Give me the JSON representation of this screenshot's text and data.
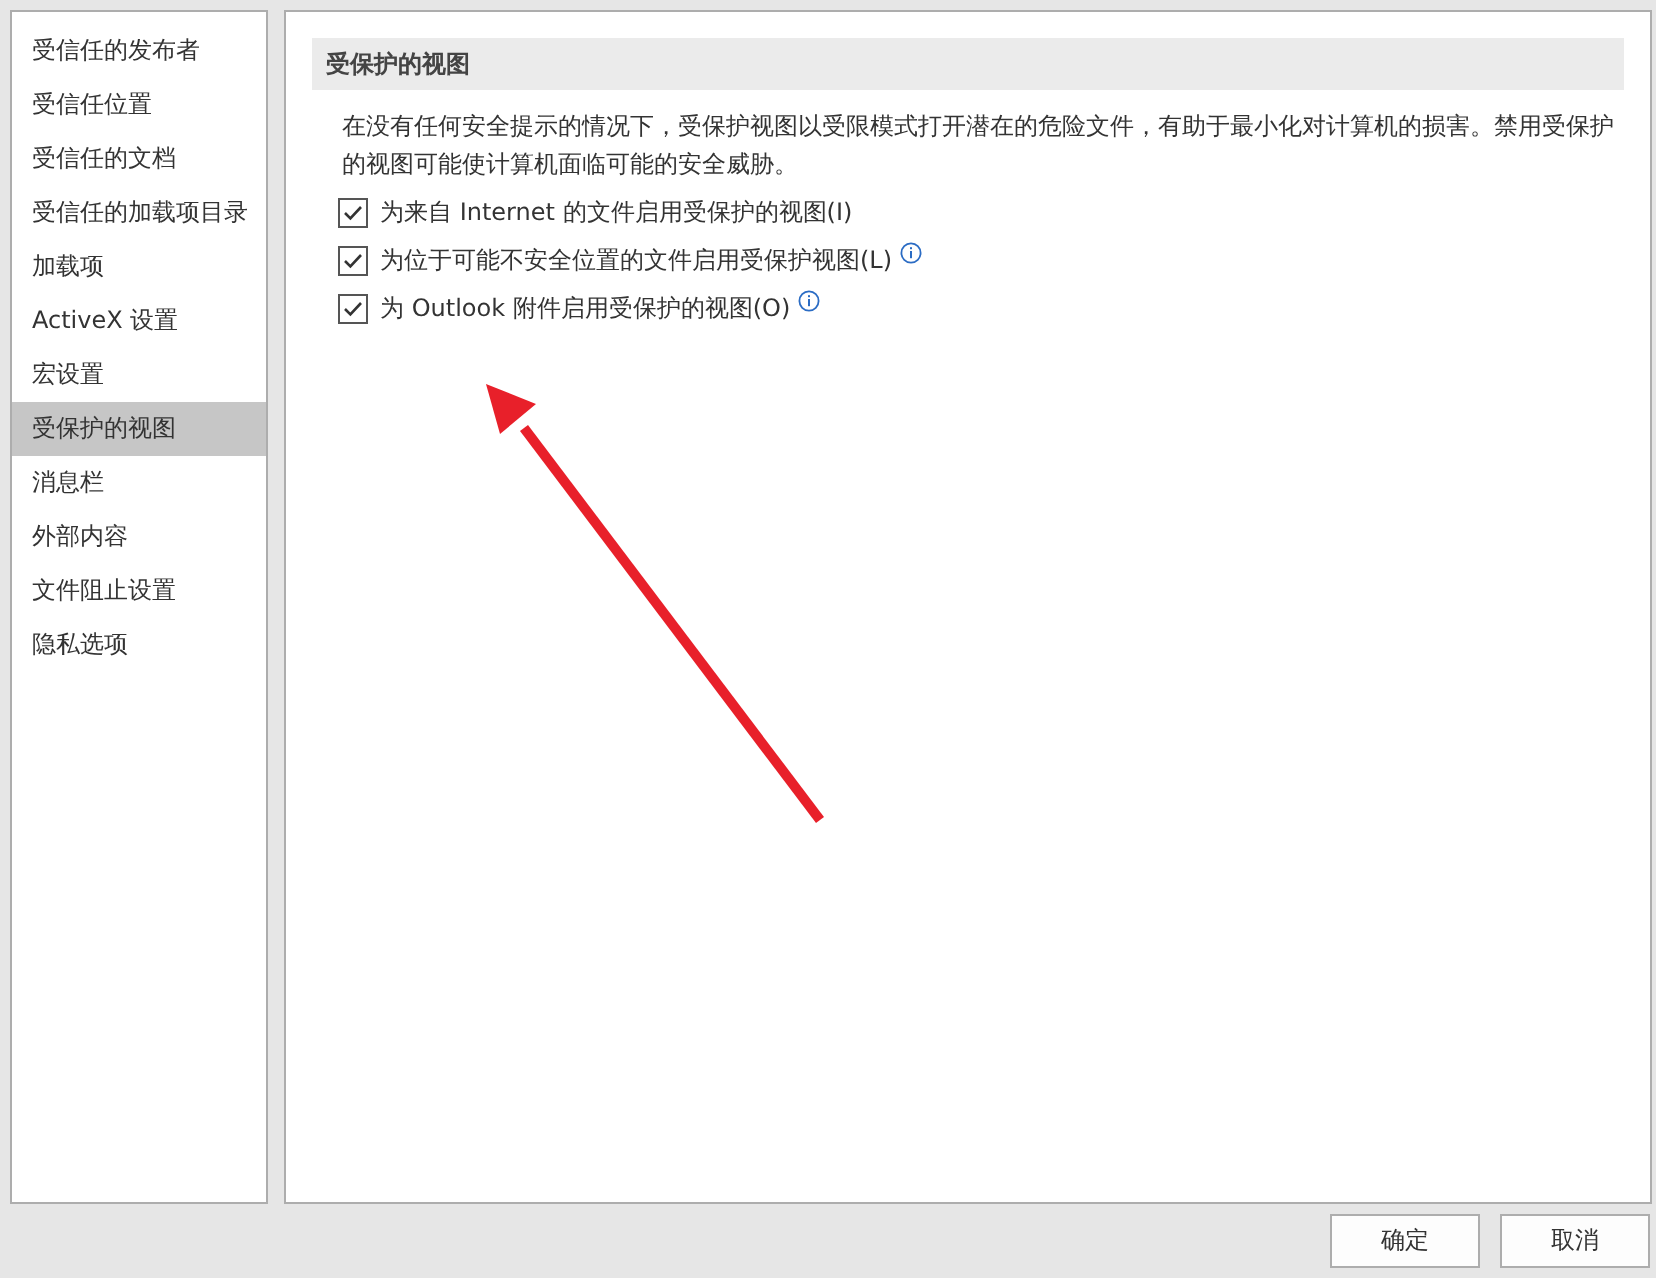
{
  "sidebar": {
    "items": [
      {
        "label": "受信任的发布者",
        "selected": false
      },
      {
        "label": "受信任位置",
        "selected": false
      },
      {
        "label": "受信任的文档",
        "selected": false
      },
      {
        "label": "受信任的加载项目录",
        "selected": false
      },
      {
        "label": "加载项",
        "selected": false
      },
      {
        "label": "ActiveX 设置",
        "selected": false
      },
      {
        "label": "宏设置",
        "selected": false
      },
      {
        "label": "受保护的视图",
        "selected": true
      },
      {
        "label": "消息栏",
        "selected": false
      },
      {
        "label": "外部内容",
        "selected": false
      },
      {
        "label": "文件阻止设置",
        "selected": false
      },
      {
        "label": "隐私选项",
        "selected": false
      }
    ]
  },
  "section": {
    "title": "受保护的视图",
    "description": "在没有任何安全提示的情况下，受保护视图以受限模式打开潜在的危险文件，有助于最小化对计算机的损害。禁用受保护的视图可能使计算机面临可能的安全威胁。",
    "options": [
      {
        "label": "为来自 Internet 的文件启用受保护的视图(I)",
        "checked": true,
        "info": false
      },
      {
        "label": "为位于可能不安全位置的文件启用受保护视图(L)",
        "checked": true,
        "info": true
      },
      {
        "label": "为 Outlook 附件启用受保护的视图(O)",
        "checked": true,
        "info": true
      }
    ]
  },
  "buttons": [
    "确定",
    "取消"
  ]
}
